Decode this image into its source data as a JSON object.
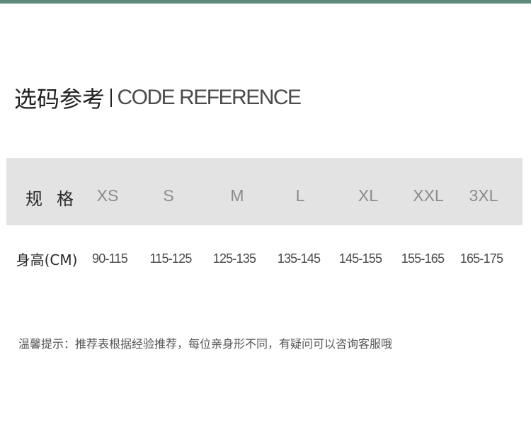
{
  "theme": {
    "top_bar_color": "#5e8a7a",
    "header_bg": "#e3e3e3"
  },
  "title": {
    "cn": "选码参考",
    "en": "CODE REFERENCE"
  },
  "table": {
    "header_label": "规格",
    "sizes": [
      "XS",
      "S",
      "M",
      "L",
      "XL",
      "XXL",
      "3XL"
    ],
    "row_label": "身高(CM)",
    "values": [
      "90-115",
      "115-125",
      "125-135",
      "135-145",
      "145-155",
      "155-165",
      "165-175"
    ]
  },
  "tip": "温馨提示：推荐表根据经验推荐，每位亲身形不同，有疑问可以咨询客服哦"
}
